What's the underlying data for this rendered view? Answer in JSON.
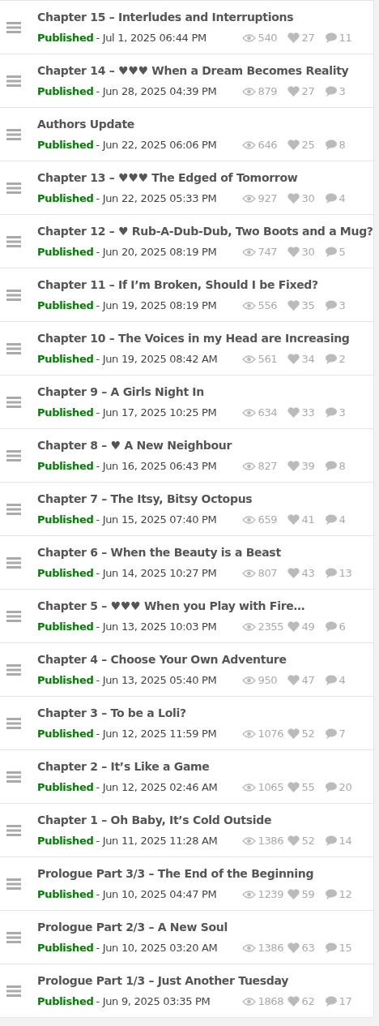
{
  "chapters": [
    {
      "title": "Chapter 15 – Interludes and Interruptions",
      "status": "Published",
      "published": true,
      "date": "- Jul 1, 2025 06:44 PM",
      "views": "540",
      "likes": "27",
      "comments": "11"
    },
    {
      "title": "Chapter 14 – ♥♥♥ When a Dream Becomes Reality",
      "status": "Published",
      "published": true,
      "date": "- Jun 28, 2025 04:39 PM",
      "views": "879",
      "likes": "27",
      "comments": "3"
    },
    {
      "title": "Authors Update",
      "status": "Published",
      "published": true,
      "date": "- Jun 22, 2025 06:06 PM",
      "views": "646",
      "likes": "25",
      "comments": "8"
    },
    {
      "title": "Chapter 13 – ♥♥♥ The Edged of Tomorrow",
      "status": "Published",
      "published": true,
      "date": "- Jun 22, 2025 05:33 PM",
      "views": "927",
      "likes": "30",
      "comments": "4"
    },
    {
      "title": "Chapter 12 – ♥ Rub-A-Dub-Dub, Two Boots and a Mug?",
      "status": "Published",
      "published": true,
      "date": "- Jun 20, 2025 08:19 PM",
      "views": "747",
      "likes": "30",
      "comments": "5"
    },
    {
      "title": "Chapter 11 – If I’m Broken, Should I be Fixed?",
      "status": "Published",
      "published": true,
      "date": "- Jun 19, 2025 08:19 PM",
      "views": "556",
      "likes": "35",
      "comments": "3"
    },
    {
      "title": "Chapter 10 – The Voices in my Head are Increasing",
      "status": "Published",
      "published": true,
      "date": "- Jun 19, 2025 08:42 AM",
      "views": "561",
      "likes": "34",
      "comments": "2"
    },
    {
      "title": "Chapter 9 – A Girls Night In",
      "status": "Published",
      "published": true,
      "date": "- Jun 17, 2025 10:25 PM",
      "views": "634",
      "likes": "33",
      "comments": "3"
    },
    {
      "title": "Chapter 8 – ♥ A New Neighbour",
      "status": "Published",
      "published": true,
      "date": "- Jun 16, 2025 06:43 PM",
      "views": "827",
      "likes": "39",
      "comments": "8"
    },
    {
      "title": "Chapter 7 – The Itsy, Bitsy Octopus",
      "status": "Published",
      "published": true,
      "date": "- Jun 15, 2025 07:40 PM",
      "views": "659",
      "likes": "41",
      "comments": "4"
    },
    {
      "title": "Chapter 6 – When the Beauty is a Beast",
      "status": "Published",
      "published": true,
      "date": "- Jun 14, 2025 10:27 PM",
      "views": "807",
      "likes": "43",
      "comments": "13"
    },
    {
      "title": "Chapter 5 – ♥♥♥ When you Play with Fire…",
      "status": "Published",
      "published": true,
      "date": "- Jun 13, 2025 10:03 PM",
      "views": "2355",
      "likes": "49",
      "comments": "6"
    },
    {
      "title": "Chapter 4 – Choose Your Own Adventure",
      "status": "Published",
      "published": true,
      "date": "- Jun 13, 2025 05:40 PM",
      "views": "950",
      "likes": "47",
      "comments": "4"
    },
    {
      "title": "Chapter 3 – To be a Loli?",
      "status": "Published",
      "published": true,
      "date": "- Jun 12, 2025 11:59 PM",
      "views": "1076",
      "likes": "52",
      "comments": "7"
    },
    {
      "title": "Chapter 2 – It’s Like a Game",
      "status": "Published",
      "published": true,
      "date": "- Jun 12, 2025 02:46 AM",
      "views": "1065",
      "likes": "55",
      "comments": "20"
    },
    {
      "title": "Chapter 1 – Oh Baby, It’s Cold Outside",
      "status": "Published",
      "published": true,
      "date": "- Jun 11, 2025 11:28 AM",
      "views": "1386",
      "likes": "52",
      "comments": "14"
    },
    {
      "title": "Prologue Part 3/3 – The End of the Beginning",
      "status": "Published",
      "published": true,
      "date": "- Jun 10, 2025 04:47 PM",
      "views": "1239",
      "likes": "59",
      "comments": "12"
    },
    {
      "title": "Prologue Part 2/3 – A New Soul",
      "status": "Published",
      "published": true,
      "date": "- Jun 10, 2025 03:20 AM",
      "views": "1386",
      "likes": "63",
      "comments": "15"
    },
    {
      "title": "Prologue Part 1/3 – Just Another Tuesday",
      "status": "Published",
      "published": true,
      "date": "- Jun 9, 2025 03:35 PM",
      "views": "1868",
      "likes": "62",
      "comments": "17"
    }
  ]
}
